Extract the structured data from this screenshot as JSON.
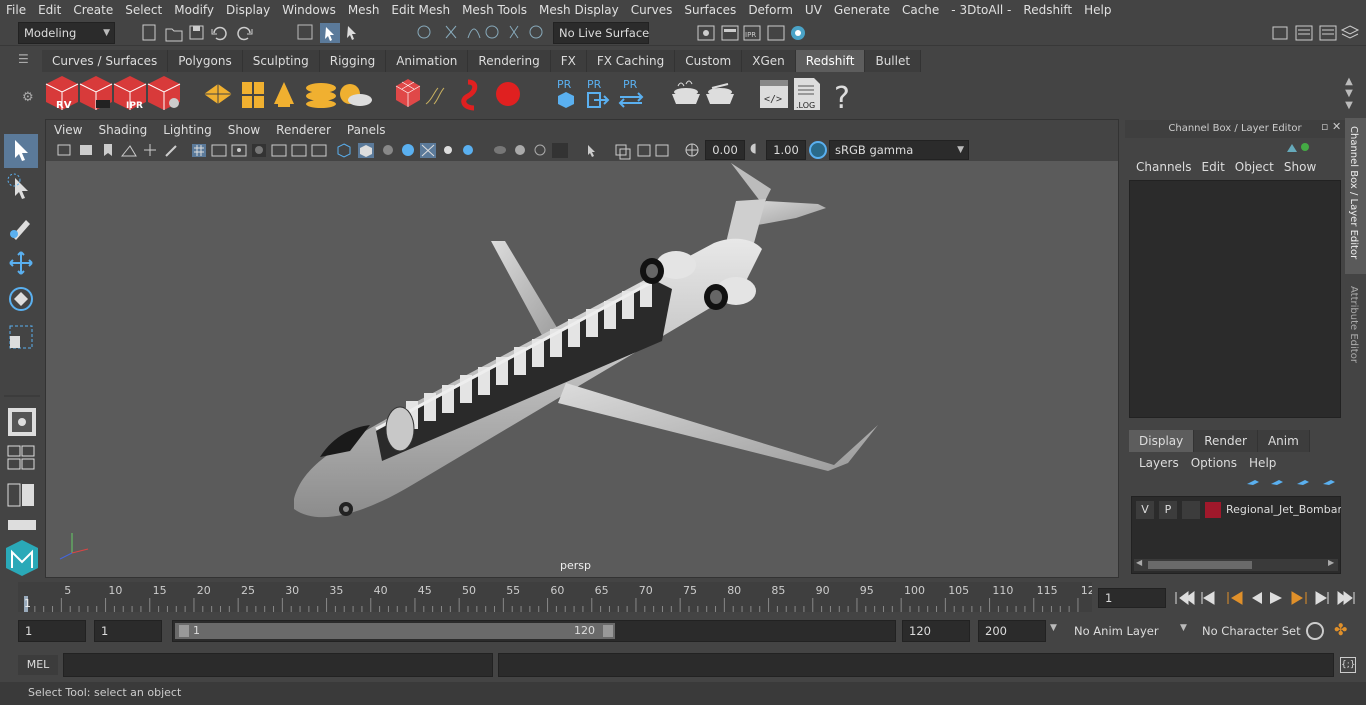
{
  "menubar": {
    "items": [
      "File",
      "Edit",
      "Create",
      "Select",
      "Modify",
      "Display",
      "Windows",
      "Mesh",
      "Edit Mesh",
      "Mesh Tools",
      "Mesh Display",
      "Curves",
      "Surfaces",
      "Deform",
      "UV",
      "Generate",
      "Cache",
      "- 3DtoAll -",
      "Redshift",
      "Help"
    ]
  },
  "status": {
    "mode": "Modeling",
    "live_surface": "No Live Surface"
  },
  "shelf": {
    "tabs": [
      "Curves / Surfaces",
      "Polygons",
      "Sculpting",
      "Rigging",
      "Animation",
      "Rendering",
      "FX",
      "FX Caching",
      "Custom",
      "XGen",
      "Redshift",
      "Bullet"
    ],
    "active": "Redshift",
    "labels": {
      "rv": "RV",
      "ipr": "IPR",
      "pr1": "PR",
      "pr2": "PR",
      "pr3": "PR",
      "log": ".LOG",
      "help": "?"
    }
  },
  "viewport": {
    "menu": [
      "View",
      "Shading",
      "Lighting",
      "Show",
      "Renderer",
      "Panels"
    ],
    "exposure": "0.00",
    "gamma": "1.00",
    "color_space": "sRGB gamma",
    "camera": "persp"
  },
  "channelbox": {
    "title": "Channel Box / Layer Editor",
    "menu": [
      "Channels",
      "Edit",
      "Object",
      "Show"
    ],
    "side_tabs": [
      "Channel Box / Layer Editor",
      "Attribute Editor"
    ],
    "layer_tabs": [
      "Display",
      "Render",
      "Anim"
    ],
    "layer_menu": [
      "Layers",
      "Options",
      "Help"
    ],
    "layer": {
      "v": "V",
      "p": "P",
      "name": "Regional_Jet_Bombard",
      "color": "#a0182b"
    }
  },
  "timeline": {
    "ticks": [
      "5",
      "10",
      "15",
      "20",
      "25",
      "30",
      "35",
      "40",
      "45",
      "50",
      "55",
      "60",
      "65",
      "70",
      "75",
      "80",
      "85",
      "90",
      "95",
      "100",
      "105",
      "110",
      "115",
      "12"
    ],
    "start_marker": "1",
    "current_frame": "1"
  },
  "range": {
    "start": "1",
    "playback_start": "1",
    "slider_start": "1",
    "slider_end": "120",
    "end": "120",
    "anim_end": "200",
    "anim_layer": "No Anim Layer",
    "char_set": "No Character Set"
  },
  "mel": {
    "label": "MEL"
  },
  "help": {
    "text": "Select Tool: select an object"
  }
}
